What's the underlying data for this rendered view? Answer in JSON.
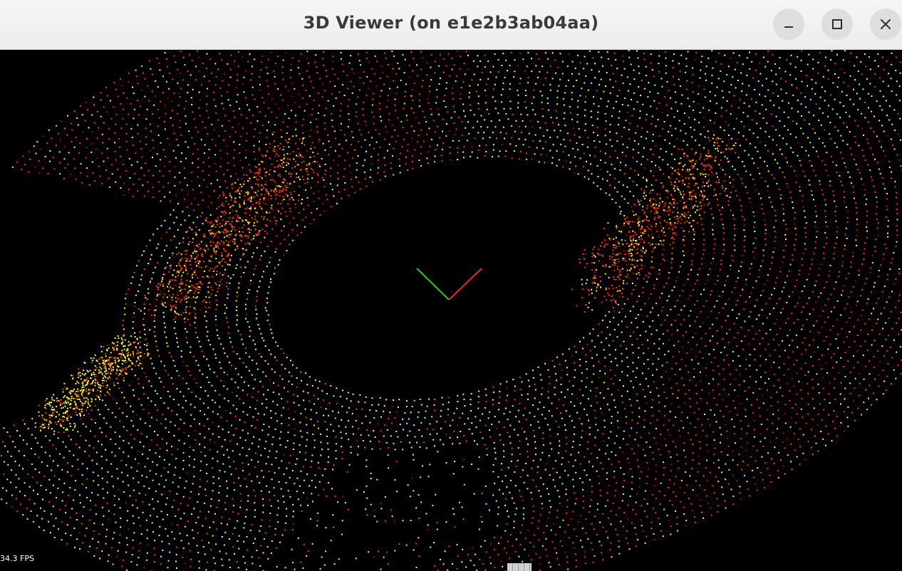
{
  "window": {
    "title": "3D Viewer (on e1e2b3ab04aa)",
    "buttons": {
      "minimize_icon": "minimize-icon",
      "maximize_icon": "maximize-icon",
      "close_icon": "close-icon"
    }
  },
  "viewport": {
    "background": "#000000",
    "fps_text": "34.3 FPS",
    "axes_colors": {
      "x_axis": "#ff2020",
      "y_axis": "#20d020"
    },
    "point_colors": [
      "#ff3300",
      "#ff6600",
      "#ffff33",
      "#ccff33",
      "#b00000"
    ]
  }
}
